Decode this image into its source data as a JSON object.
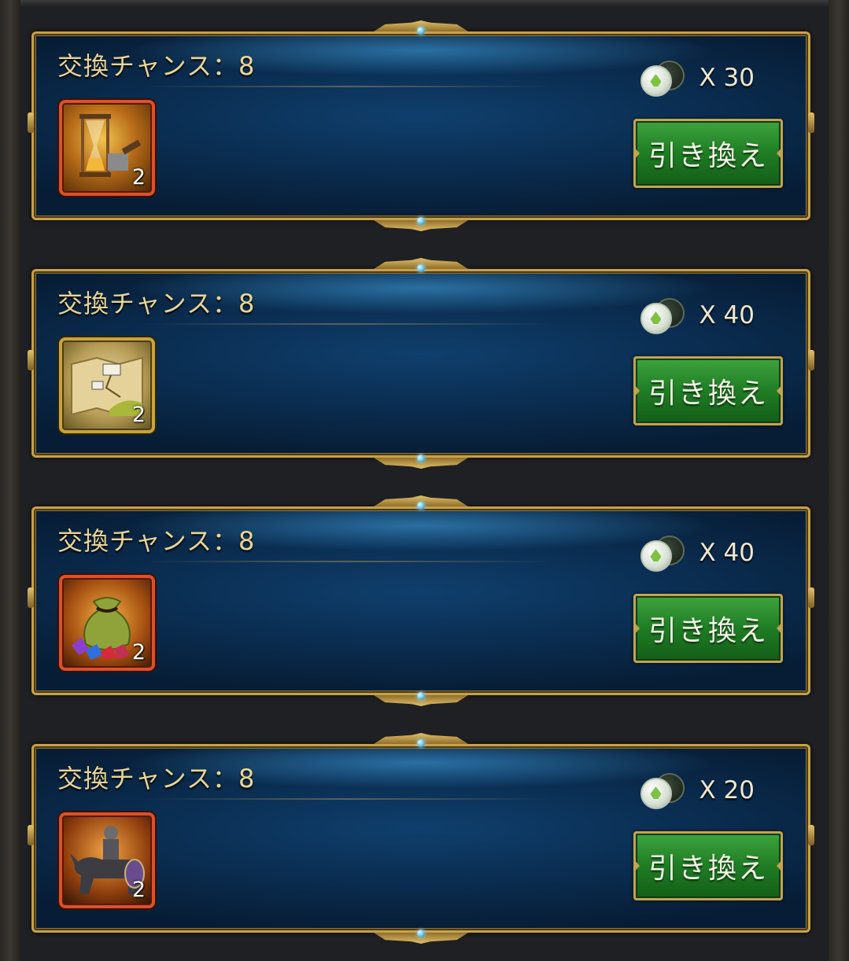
{
  "offers": [
    {
      "chance_label": "交換チャンス：8",
      "cost": "X 30",
      "quantity": "2",
      "item_icon": "hourglass-hammer-icon",
      "button_label": "引き換え",
      "frame": "orange"
    },
    {
      "chance_label": "交換チャンス：8",
      "cost": "X 40",
      "quantity": "2",
      "item_icon": "map-icon",
      "button_label": "引き換え",
      "frame": "gold"
    },
    {
      "chance_label": "交換チャンス：8",
      "cost": "X 40",
      "quantity": "2",
      "item_icon": "gem-bag-icon",
      "button_label": "引き換え",
      "frame": "orange"
    },
    {
      "chance_label": "交換チャンス：8",
      "cost": "X 20",
      "quantity": "2",
      "item_icon": "cavalry-knight-icon",
      "button_label": "引き換え",
      "frame": "orange"
    }
  ],
  "currency_icon": "coin-icon",
  "colors": {
    "button_green": "#1f7d24",
    "frame_gold": "#c6a14a",
    "frame_orange": "#d9522a",
    "label_gold": "#e9d597"
  }
}
